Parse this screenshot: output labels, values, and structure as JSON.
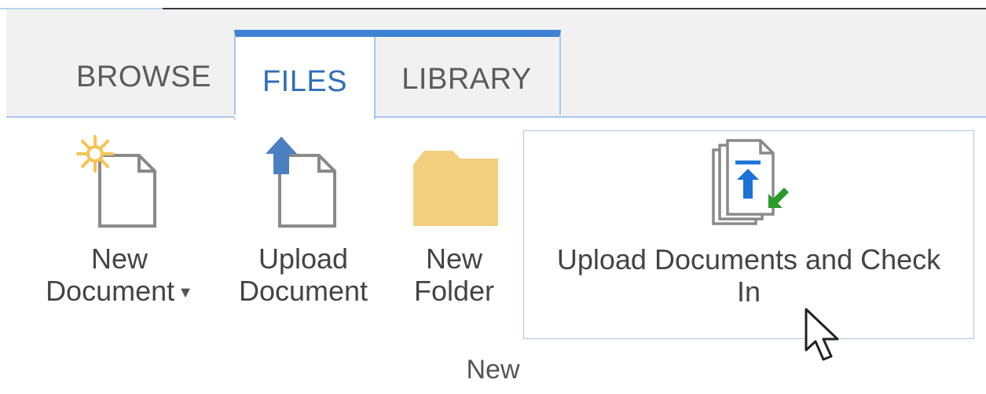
{
  "tabs": [
    {
      "label": "BROWSE",
      "active": false
    },
    {
      "label": "FILES",
      "active": true
    },
    {
      "label": "LIBRARY",
      "active": false
    }
  ],
  "ribbon": {
    "new_document": {
      "line1": "New",
      "line2": "Document",
      "has_dropdown": true,
      "icon": "new-document-icon"
    },
    "upload_document": {
      "line1": "Upload",
      "line2": "Document",
      "icon": "upload-document-icon"
    },
    "new_folder": {
      "line1": "New",
      "line2": "Folder",
      "icon": "folder-icon"
    },
    "upload_check_in": {
      "line1": "Upload Documents and Check",
      "line2": "In",
      "icon": "upload-check-in-icon"
    },
    "group_label": "New"
  },
  "colors": {
    "accent": "#3e82d3",
    "tab_border": "#a7c6ea",
    "folder": "#f2cf7f",
    "star": "#f6c453",
    "check_in_arrow": "#2a9a2a"
  }
}
